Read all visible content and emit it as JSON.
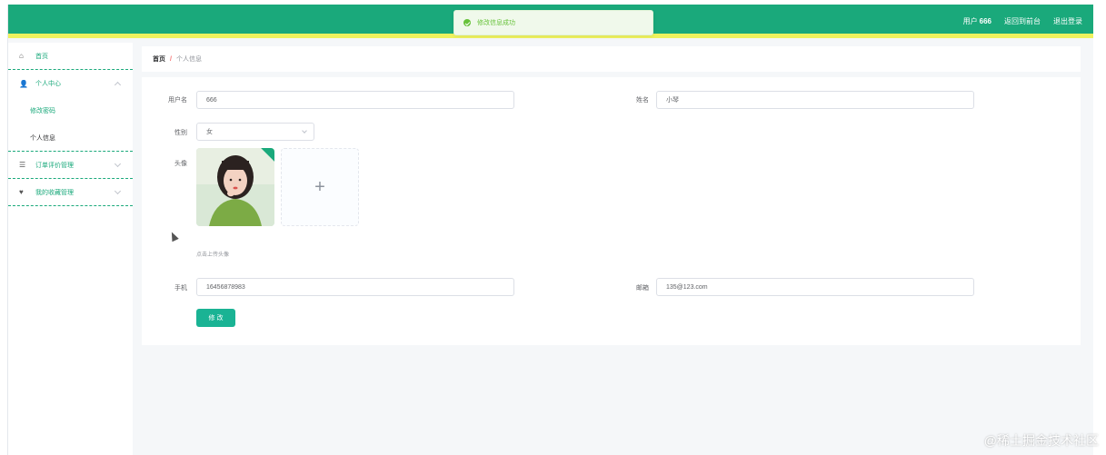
{
  "header": {
    "user_label": "用户",
    "user_name": "666",
    "links": [
      "返回到前台",
      "退出登录"
    ]
  },
  "toast": {
    "message": "修改信息成功"
  },
  "sidebar": {
    "home": "首页",
    "personal_center": "个人中心",
    "personal_sub": [
      "修改密码",
      "个人信息"
    ],
    "order_menu": "订单评价管理",
    "extra_menu": "我的收藏管理"
  },
  "breadcrumb": {
    "home": "首页",
    "separator": "/",
    "current": "个人信息"
  },
  "form": {
    "username_label": "用户名",
    "username_value": "666",
    "name_label": "姓名",
    "name_value": "小琴",
    "gender_label": "性别",
    "gender_value": "女",
    "avatar_label": "头像",
    "upload_plus": "+",
    "upload_hint": "点击上传头像",
    "phone_label": "手机",
    "phone_value": "16456878983",
    "email_label": "邮箱",
    "email_value": "135@123.com",
    "submit_label": "修 改"
  },
  "watermark": "@稀土掘金技术社区",
  "colors": {
    "primary": "#1aa97b",
    "accent_stripe": "#eef25e",
    "button": "#1ab394"
  }
}
